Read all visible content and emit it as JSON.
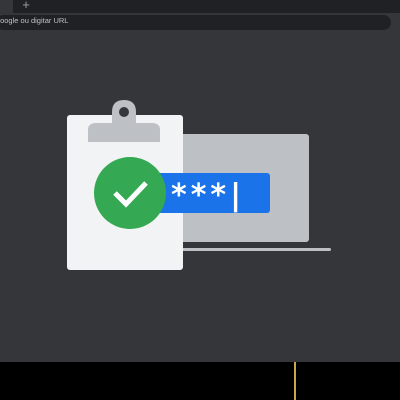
{
  "browser": {
    "new_tab_symbol": "+",
    "omnibox_placeholder": "o Google ou digitar URL"
  },
  "illustration": {
    "password_mask": "***|",
    "icons": [
      "clipboard-icon",
      "checkmark-icon",
      "laptop-icon"
    ],
    "colors": {
      "background": "#35363a",
      "clipboard": "#f1f3f4",
      "clip": "#bdc1c6",
      "laptop": "#bdc1c6",
      "check_circle": "#34a853",
      "password_field": "#1a73e8"
    }
  }
}
